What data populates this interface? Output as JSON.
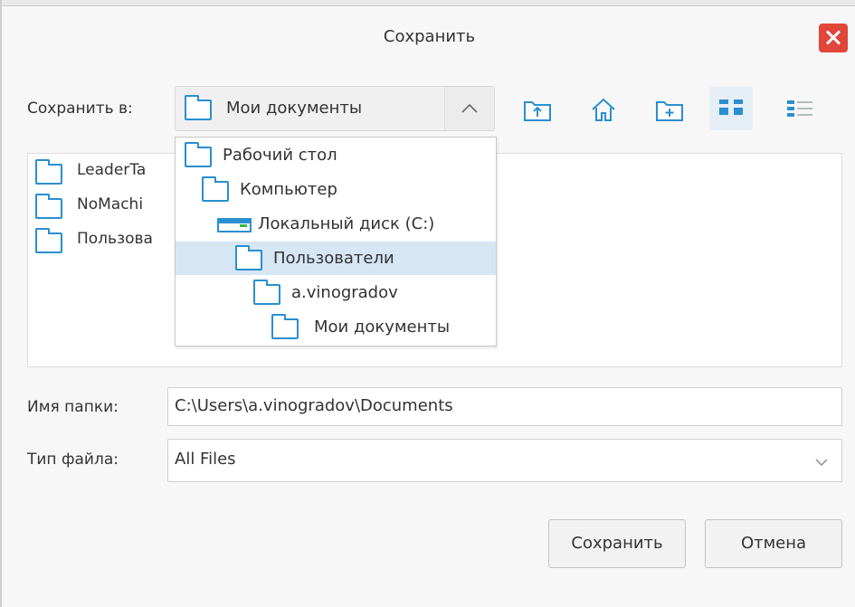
{
  "dialog": {
    "title": "Сохранить"
  },
  "look_in": {
    "label": "Сохранить в:",
    "value": "Мои документы"
  },
  "toolbar": {
    "icons": [
      "folder-up-icon",
      "home-icon",
      "new-folder-icon",
      "icon-view-icon",
      "list-view-icon"
    ]
  },
  "files": [
    {
      "name": "LeaderTa"
    },
    {
      "name": "NoMachi"
    },
    {
      "name": "Пользова"
    }
  ],
  "dropdown": {
    "items": [
      {
        "name": "Рабочий стол",
        "icon": "folder-icon"
      },
      {
        "name": "Компьютер",
        "icon": "folder-icon"
      },
      {
        "name": "Локальный диск (C:)",
        "icon": "drive-icon"
      },
      {
        "name": "Пользователи",
        "icon": "folder-icon",
        "selected": true
      },
      {
        "name": "a.vinogradov",
        "icon": "folder-icon"
      },
      {
        "name": "Мои документы",
        "icon": "folder-icon"
      }
    ]
  },
  "folder_name": {
    "label": "Имя папки:",
    "value": "C:\\Users\\a.vinogradov\\Documents"
  },
  "file_type": {
    "label": "Тип файла:",
    "value": "All Files"
  },
  "buttons": {
    "save": "Сохранить",
    "cancel": "Отмена"
  },
  "colors": {
    "accent": "#2a8fd0",
    "close": "#e0463a",
    "selection": "#d6e6f5"
  }
}
